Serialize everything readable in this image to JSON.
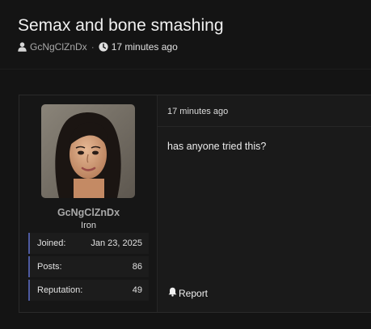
{
  "thread": {
    "title": "Semax and bone smashing",
    "author": "GcNgClZnDx",
    "separator": "·",
    "time_ago": "17 minutes ago"
  },
  "post": {
    "user": {
      "name": "GcNgClZnDx",
      "rank": "Iron",
      "stats": [
        {
          "label": "Joined:",
          "value": "Jan 23, 2025"
        },
        {
          "label": "Posts:",
          "value": "86"
        },
        {
          "label": "Reputation:",
          "value": "49"
        }
      ],
      "stat_accent_color": "#4d5aa0"
    },
    "time_ago": "17 minutes ago",
    "body": "has anyone tried this?",
    "report_label": "Report"
  },
  "icons": {
    "author": "user-icon",
    "time": "clock-icon",
    "report": "bell-icon"
  }
}
